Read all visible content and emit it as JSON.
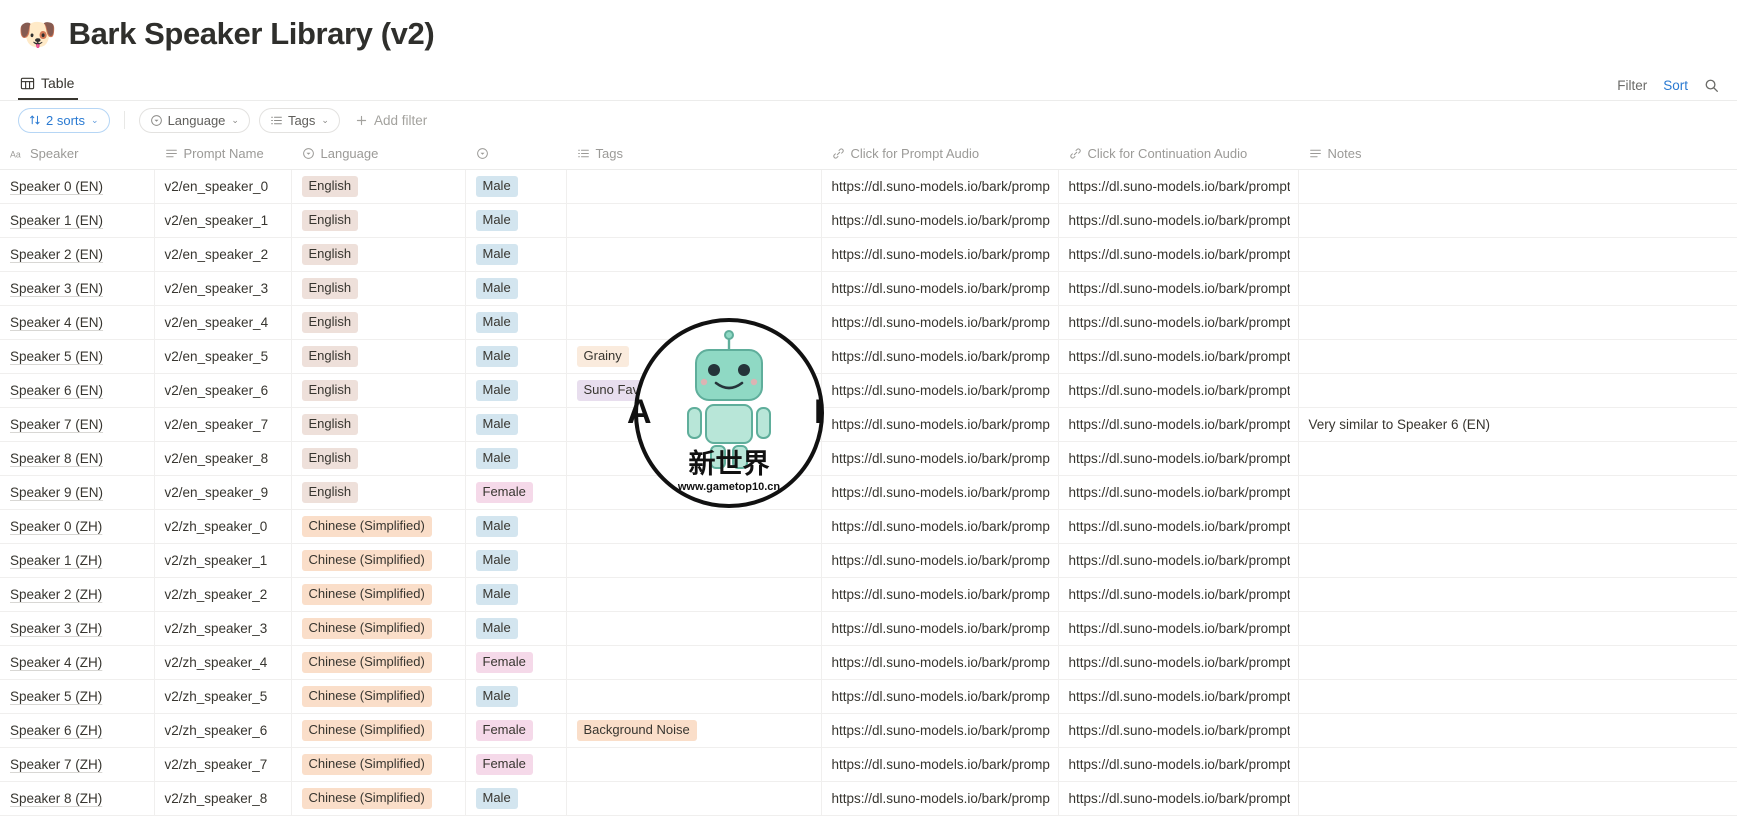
{
  "page": {
    "emoji": "🐶",
    "title": "Bark Speaker Library (v2)"
  },
  "viewbar": {
    "tab_label": "Table",
    "tab_icon": "table-icon",
    "filter_label": "Filter",
    "sort_label": "Sort",
    "search_icon": "search-icon"
  },
  "filterbar": {
    "sorts_chip": "2 sorts",
    "language_chip": "Language",
    "tags_chip": "Tags",
    "add_filter": "Add filter",
    "caret": "⌄"
  },
  "colors": {
    "accent_blue": "#2a7ad2",
    "pill_english": "#eee0da",
    "pill_chinese": "#fadec9",
    "pill_male": "#d3e5ef",
    "pill_female": "#f5d9e9",
    "pill_grainy": "#faebdd",
    "pill_suno": "#e8deee",
    "pill_background_noise": "#fadec9"
  },
  "table": {
    "columns": [
      {
        "label": "Speaker",
        "icon": "title-text-icon"
      },
      {
        "label": "Prompt Name",
        "icon": "text-lines-icon"
      },
      {
        "label": "Language",
        "icon": "select-circle-icon"
      },
      {
        "label": "",
        "icon": "select-circle-icon"
      },
      {
        "label": "Tags",
        "icon": "multi-select-icon"
      },
      {
        "label": "Click for Prompt Audio",
        "icon": "link-icon"
      },
      {
        "label": "Click for Continuation Audio",
        "icon": "link-icon"
      },
      {
        "label": "Notes",
        "icon": "text-lines-icon"
      }
    ],
    "url_prompt": "https://dl.suno-models.io/bark/prompts/",
    "url_continuation": "https://dl.suno-models.io/bark/prompts/",
    "rows": [
      {
        "speaker": "Speaker 0 (EN)",
        "prompt": "v2/en_speaker_0",
        "language": "English",
        "lang_class": "pill-english",
        "gender": "Male",
        "gender_class": "pill-male",
        "tag": "",
        "tag_class": "",
        "notes": ""
      },
      {
        "speaker": "Speaker 1 (EN)",
        "prompt": "v2/en_speaker_1",
        "language": "English",
        "lang_class": "pill-english",
        "gender": "Male",
        "gender_class": "pill-male",
        "tag": "",
        "tag_class": "",
        "notes": ""
      },
      {
        "speaker": "Speaker 2 (EN)",
        "prompt": "v2/en_speaker_2",
        "language": "English",
        "lang_class": "pill-english",
        "gender": "Male",
        "gender_class": "pill-male",
        "tag": "",
        "tag_class": "",
        "notes": ""
      },
      {
        "speaker": "Speaker 3 (EN)",
        "prompt": "v2/en_speaker_3",
        "language": "English",
        "lang_class": "pill-english",
        "gender": "Male",
        "gender_class": "pill-male",
        "tag": "",
        "tag_class": "",
        "notes": ""
      },
      {
        "speaker": "Speaker 4 (EN)",
        "prompt": "v2/en_speaker_4",
        "language": "English",
        "lang_class": "pill-english",
        "gender": "Male",
        "gender_class": "pill-male",
        "tag": "",
        "tag_class": "",
        "notes": ""
      },
      {
        "speaker": "Speaker 5 (EN)",
        "prompt": "v2/en_speaker_5",
        "language": "English",
        "lang_class": "pill-english",
        "gender": "Male",
        "gender_class": "pill-male",
        "tag": "Grainy",
        "tag_class": "pill-grainy",
        "notes": ""
      },
      {
        "speaker": "Speaker 6 (EN)",
        "prompt": "v2/en_speaker_6",
        "language": "English",
        "lang_class": "pill-english",
        "gender": "Male",
        "gender_class": "pill-male",
        "tag": "Suno Favorite",
        "tag_class": "pill-suno",
        "notes": ""
      },
      {
        "speaker": "Speaker 7 (EN)",
        "prompt": "v2/en_speaker_7",
        "language": "English",
        "lang_class": "pill-english",
        "gender": "Male",
        "gender_class": "pill-male",
        "tag": "",
        "tag_class": "",
        "notes": "Very similar to Speaker 6 (EN)"
      },
      {
        "speaker": "Speaker 8 (EN)",
        "prompt": "v2/en_speaker_8",
        "language": "English",
        "lang_class": "pill-english",
        "gender": "Male",
        "gender_class": "pill-male",
        "tag": "",
        "tag_class": "",
        "notes": ""
      },
      {
        "speaker": "Speaker 9 (EN)",
        "prompt": "v2/en_speaker_9",
        "language": "English",
        "lang_class": "pill-english",
        "gender": "Female",
        "gender_class": "pill-female",
        "tag": "",
        "tag_class": "",
        "notes": ""
      },
      {
        "speaker": "Speaker 0 (ZH)",
        "prompt": "v2/zh_speaker_0",
        "language": "Chinese (Simplified)",
        "lang_class": "pill-chinese",
        "gender": "Male",
        "gender_class": "pill-male",
        "tag": "",
        "tag_class": "",
        "notes": ""
      },
      {
        "speaker": "Speaker 1 (ZH)",
        "prompt": "v2/zh_speaker_1",
        "language": "Chinese (Simplified)",
        "lang_class": "pill-chinese",
        "gender": "Male",
        "gender_class": "pill-male",
        "tag": "",
        "tag_class": "",
        "notes": ""
      },
      {
        "speaker": "Speaker 2 (ZH)",
        "prompt": "v2/zh_speaker_2",
        "language": "Chinese (Simplified)",
        "lang_class": "pill-chinese",
        "gender": "Male",
        "gender_class": "pill-male",
        "tag": "",
        "tag_class": "",
        "notes": ""
      },
      {
        "speaker": "Speaker 3 (ZH)",
        "prompt": "v2/zh_speaker_3",
        "language": "Chinese (Simplified)",
        "lang_class": "pill-chinese",
        "gender": "Male",
        "gender_class": "pill-male",
        "tag": "",
        "tag_class": "",
        "notes": ""
      },
      {
        "speaker": "Speaker 4 (ZH)",
        "prompt": "v2/zh_speaker_4",
        "language": "Chinese (Simplified)",
        "lang_class": "pill-chinese",
        "gender": "Female",
        "gender_class": "pill-female",
        "tag": "",
        "tag_class": "",
        "notes": ""
      },
      {
        "speaker": "Speaker 5 (ZH)",
        "prompt": "v2/zh_speaker_5",
        "language": "Chinese (Simplified)",
        "lang_class": "pill-chinese",
        "gender": "Male",
        "gender_class": "pill-male",
        "tag": "",
        "tag_class": "",
        "notes": ""
      },
      {
        "speaker": "Speaker 6 (ZH)",
        "prompt": "v2/zh_speaker_6",
        "language": "Chinese (Simplified)",
        "lang_class": "pill-chinese",
        "gender": "Female",
        "gender_class": "pill-female",
        "tag": "Background Noise",
        "tag_class": "pill-bgnoise",
        "notes": ""
      },
      {
        "speaker": "Speaker 7 (ZH)",
        "prompt": "v2/zh_speaker_7",
        "language": "Chinese (Simplified)",
        "lang_class": "pill-chinese",
        "gender": "Female",
        "gender_class": "pill-female",
        "tag": "",
        "tag_class": "",
        "notes": ""
      },
      {
        "speaker": "Speaker 8 (ZH)",
        "prompt": "v2/zh_speaker_8",
        "language": "Chinese (Simplified)",
        "lang_class": "pill-chinese",
        "gender": "Male",
        "gender_class": "pill-male",
        "tag": "",
        "tag_class": "",
        "notes": ""
      }
    ]
  },
  "watermark": {
    "left_letter": "A",
    "right_letter": "I",
    "cn_text": "新世界",
    "site_text": "www.gametop10.cn"
  }
}
